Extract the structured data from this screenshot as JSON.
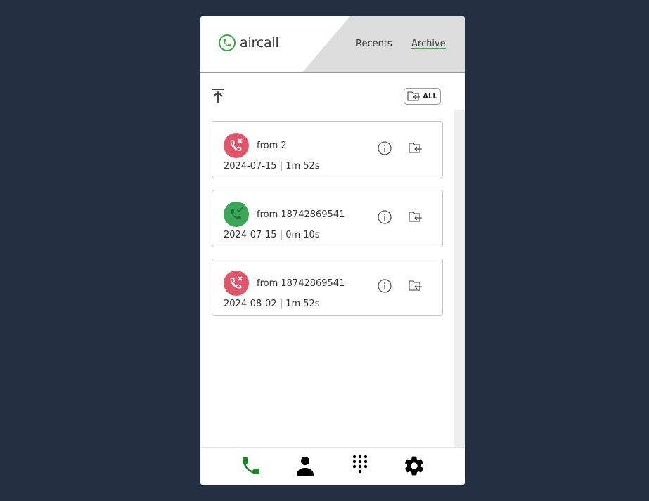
{
  "header": {
    "logo_text": "aircall",
    "nav": {
      "recents": "Recents",
      "archive": "Archive"
    }
  },
  "toolbar": {
    "archive_all_label": "ALL"
  },
  "colors": {
    "brand_green": "#2bb23c",
    "missed_red": "#e05567",
    "answered_green": "#3aa757",
    "background": "#243042"
  },
  "calls": [
    {
      "status": "missed",
      "from": "from 2",
      "meta": "2024-07-15 | 1m 52s"
    },
    {
      "status": "answered",
      "from": "from 18742869541",
      "meta": "2024-07-15 | 0m 10s"
    },
    {
      "status": "missed",
      "from": "from 18742869541",
      "meta": "2024-08-02 | 1m 52s"
    }
  ],
  "bottom_nav": [
    {
      "icon": "phone-icon",
      "active": true
    },
    {
      "icon": "contact-icon",
      "active": false
    },
    {
      "icon": "keypad-icon",
      "active": false
    },
    {
      "icon": "settings-icon",
      "active": false
    }
  ]
}
